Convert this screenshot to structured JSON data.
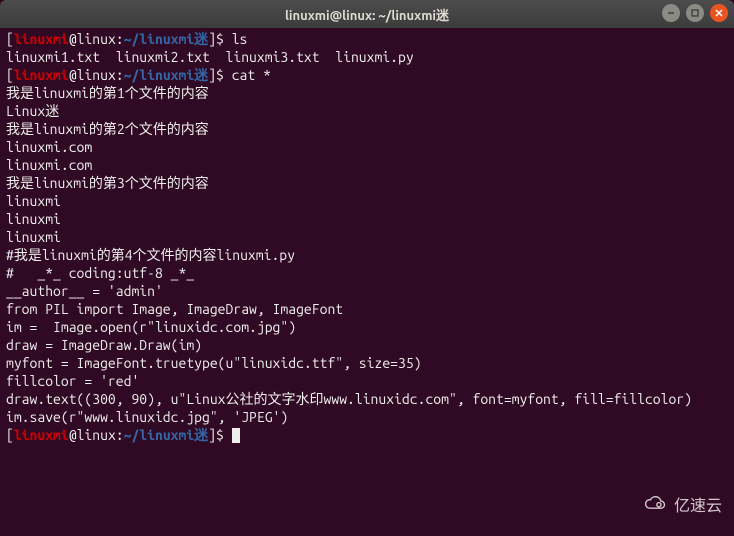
{
  "window": {
    "title": "linuxmi@linux: ~/linuxmi迷"
  },
  "prompt": {
    "open": "[",
    "user": "linuxmi",
    "at": "@",
    "host": "linux",
    "colon": ":",
    "path": "~/linuxmi迷",
    "close": "]",
    "dollar": "$ "
  },
  "session": [
    {
      "type": "cmd",
      "text": "ls"
    },
    {
      "type": "out",
      "text": "linuxmi1.txt  linuxmi2.txt  linuxmi3.txt  linuxmi.py"
    },
    {
      "type": "cmd",
      "text": "cat *"
    },
    {
      "type": "out",
      "text": "我是linuxmi的第1个文件的内容"
    },
    {
      "type": "out",
      "text": "Linux迷"
    },
    {
      "type": "out",
      "text": ""
    },
    {
      "type": "out",
      "text": "我是linuxmi的第2个文件的内容"
    },
    {
      "type": "out",
      "text": "linuxmi.com"
    },
    {
      "type": "out",
      "text": "linuxmi.com"
    },
    {
      "type": "out",
      "text": ""
    },
    {
      "type": "out",
      "text": ""
    },
    {
      "type": "out",
      "text": "我是linuxmi的第3个文件的内容"
    },
    {
      "type": "out",
      "text": "linuxmi"
    },
    {
      "type": "linuxmi",
      "text": "linuxmi"
    },
    {
      "type": "out",
      "text": "linuxmi"
    },
    {
      "type": "out",
      "text": ""
    },
    {
      "type": "out",
      "text": "#我是linuxmi的第4个文件的内容linuxmi.py"
    },
    {
      "type": "out",
      "text": "#   _*_ coding:utf-8 _*_"
    },
    {
      "type": "out",
      "text": "__author__ = 'admin'"
    },
    {
      "type": "out",
      "text": "from PIL import Image, ImageDraw, ImageFont"
    },
    {
      "type": "out",
      "text": "im =  Image.open(r\"linuxidc.com.jpg\")"
    },
    {
      "type": "out",
      "text": "draw = ImageDraw.Draw(im)"
    },
    {
      "type": "out",
      "text": "myfont = ImageFont.truetype(u\"linuxidc.ttf\", size=35)"
    },
    {
      "type": "out",
      "text": "fillcolor = 'red'"
    },
    {
      "type": "out",
      "text": "draw.text((300, 90), u\"Linux公社的文字水印www.linuxidc.com\", font=myfont, fill=fillcolor)"
    },
    {
      "type": "out",
      "text": "im.save(r\"www.linuxidc.jpg\", 'JPEG')"
    },
    {
      "type": "cmd",
      "text": "",
      "cursor": true
    }
  ],
  "watermark": {
    "text": "亿速云"
  }
}
